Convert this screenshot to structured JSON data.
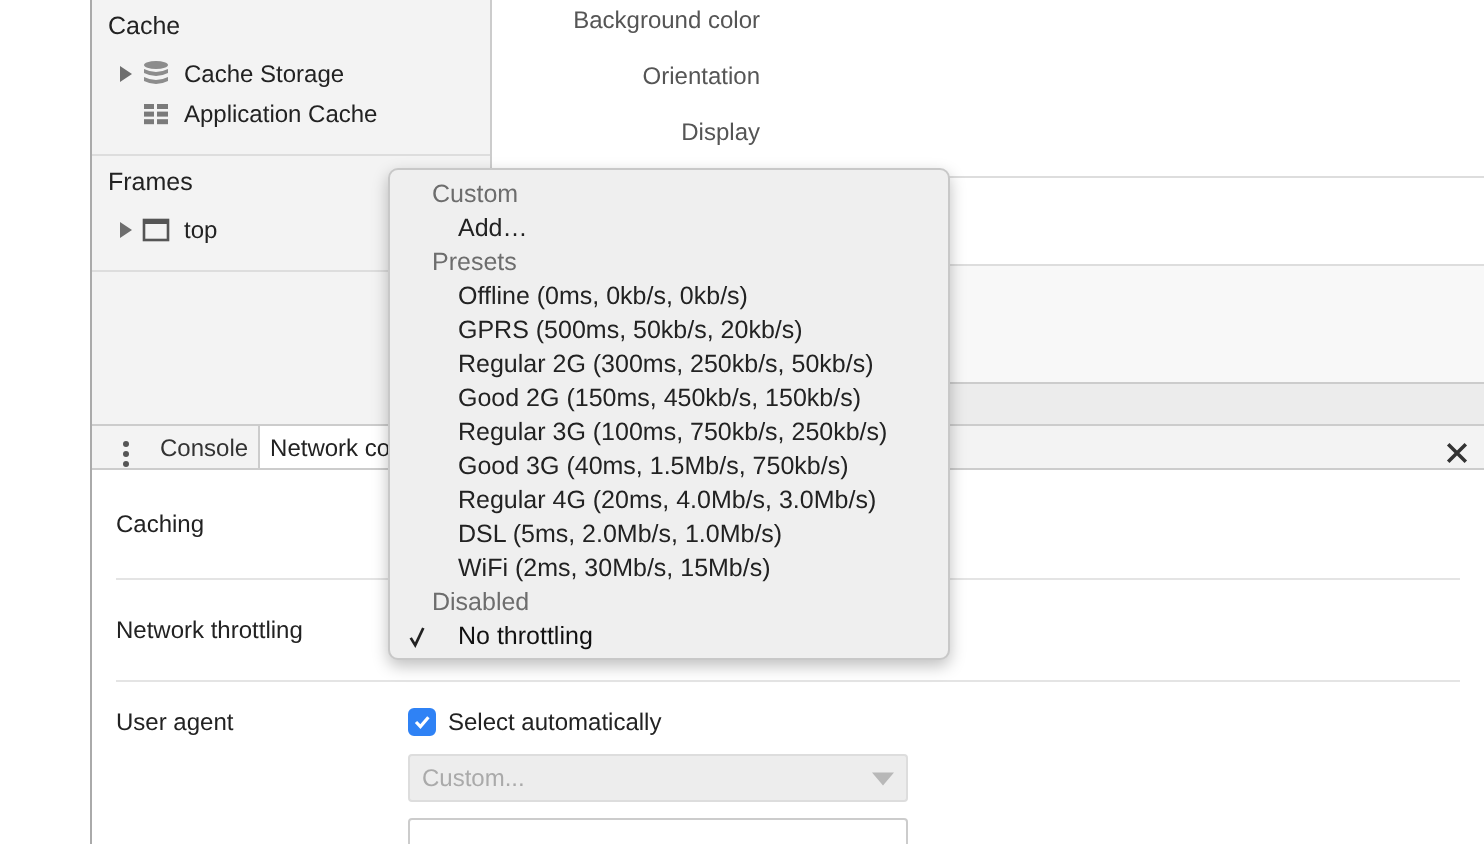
{
  "sidebar": {
    "sections": [
      {
        "title": "Cache",
        "items": [
          {
            "label": "Cache Storage",
            "kind": "database",
            "expanded": false
          },
          {
            "label": "Application Cache",
            "kind": "grid"
          }
        ]
      },
      {
        "title": "Frames",
        "items": [
          {
            "label": "top",
            "kind": "frame",
            "expanded": false
          }
        ]
      }
    ]
  },
  "properties": [
    "Background color",
    "Orientation",
    "Display"
  ],
  "drawer": {
    "tabs": [
      {
        "label": "Console",
        "selected": false
      },
      {
        "label": "Network co",
        "selected": true
      }
    ],
    "rows": [
      {
        "label": "Caching",
        "kind": "hidden"
      },
      {
        "label": "Network throttling",
        "kind": "hidden"
      },
      {
        "label": "User agent",
        "kind": "user_agent",
        "checkbox": {
          "label": "Select automatically",
          "checked": true
        },
        "select": {
          "placeholder": "Custom...",
          "disabled": true
        }
      }
    ]
  },
  "dropdown": {
    "groups": [
      {
        "header": "Custom",
        "options": [
          {
            "label": "Add…",
            "selected": false
          }
        ]
      },
      {
        "header": "Presets",
        "options": [
          {
            "label": "Offline (0ms, 0kb/s, 0kb/s)",
            "selected": false
          },
          {
            "label": "GPRS (500ms, 50kb/s, 20kb/s)",
            "selected": false
          },
          {
            "label": "Regular 2G (300ms, 250kb/s, 50kb/s)",
            "selected": false
          },
          {
            "label": "Good 2G (150ms, 450kb/s, 150kb/s)",
            "selected": false
          },
          {
            "label": "Regular 3G (100ms, 750kb/s, 250kb/s)",
            "selected": false
          },
          {
            "label": "Good 3G (40ms, 1.5Mb/s, 750kb/s)",
            "selected": false
          },
          {
            "label": "Regular 4G (20ms, 4.0Mb/s, 3.0Mb/s)",
            "selected": false
          },
          {
            "label": "DSL (5ms, 2.0Mb/s, 1.0Mb/s)",
            "selected": false
          },
          {
            "label": "WiFi (2ms, 30Mb/s, 15Mb/s)",
            "selected": false
          }
        ]
      },
      {
        "header": "Disabled",
        "options": [
          {
            "label": "No throttling",
            "selected": true
          }
        ]
      }
    ]
  }
}
